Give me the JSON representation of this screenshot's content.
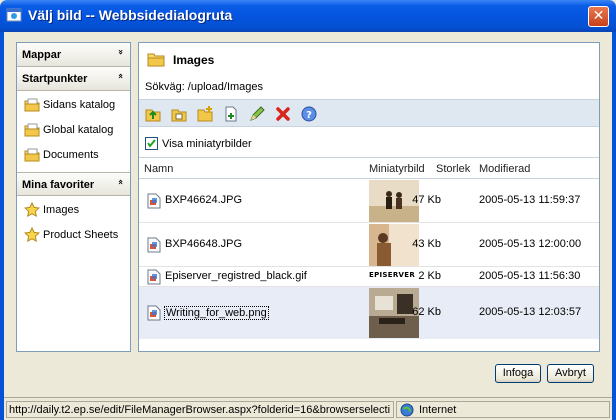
{
  "window": {
    "title": "Välj bild -- Webbsidedialogruta",
    "close_label": "✕"
  },
  "sidebar": {
    "folders": {
      "title": "Mappar",
      "chevron": "»"
    },
    "startpoints": {
      "title": "Startpunkter",
      "chevron": "«",
      "items": [
        {
          "label": "Sidans katalog",
          "icon": "folder-icon"
        },
        {
          "label": "Global katalog",
          "icon": "folder-icon"
        },
        {
          "label": "Documents",
          "icon": "folder-icon"
        }
      ]
    },
    "favorites": {
      "title": "Mina favoriter",
      "chevron": "«",
      "items": [
        {
          "label": "Images",
          "icon": "star-icon"
        },
        {
          "label": "Product Sheets",
          "icon": "star-icon"
        }
      ]
    }
  },
  "main": {
    "folder_title": "Images",
    "path": "Sökväg: /upload/Images",
    "toolbar": [
      "up-folder-icon",
      "properties-icon",
      "new-folder-icon",
      "new-file-icon",
      "rename-pencil-icon",
      "delete-icon",
      "help-icon"
    ],
    "show_thumbnails": {
      "label": "Visa miniatyrbilder",
      "checked": true
    },
    "columns": {
      "name": "Namn",
      "thumbnail": "Miniatyrbild",
      "size": "Storlek",
      "modified": "Modifierad"
    },
    "files": [
      {
        "name": "BXP46624.JPG",
        "size": "47 Kb",
        "modified": "2005-05-13 11:59:37",
        "thumb": "photo"
      },
      {
        "name": "BXP46648.JPG",
        "size": "43 Kb",
        "modified": "2005-05-13 12:00:00",
        "thumb": "photo"
      },
      {
        "name": "Episerver_registred_black.gif",
        "size": "2 Kb",
        "modified": "2005-05-13 11:56:30",
        "thumb": "logo",
        "thumb_text": "EPISERVER"
      },
      {
        "name": "Writing_for_web.png",
        "size": "62 Kb",
        "modified": "2005-05-13 12:03:57",
        "thumb": "photo",
        "selected": true
      }
    ]
  },
  "buttons": {
    "insert": "Infoga",
    "cancel": "Avbryt"
  },
  "statusbar": {
    "url": "http://daily.t2.ep.se/edit/FileManagerBrowser.aspx?folderid=16&browserselecti",
    "zone": "Internet"
  },
  "colors": {
    "titlebar": "#0555e0",
    "accent_frame": "#0553d6",
    "dialog_bg": "#ece9d8",
    "toolbar_bg": "#dfe7f1",
    "selected_row": "#e8ecf6"
  }
}
